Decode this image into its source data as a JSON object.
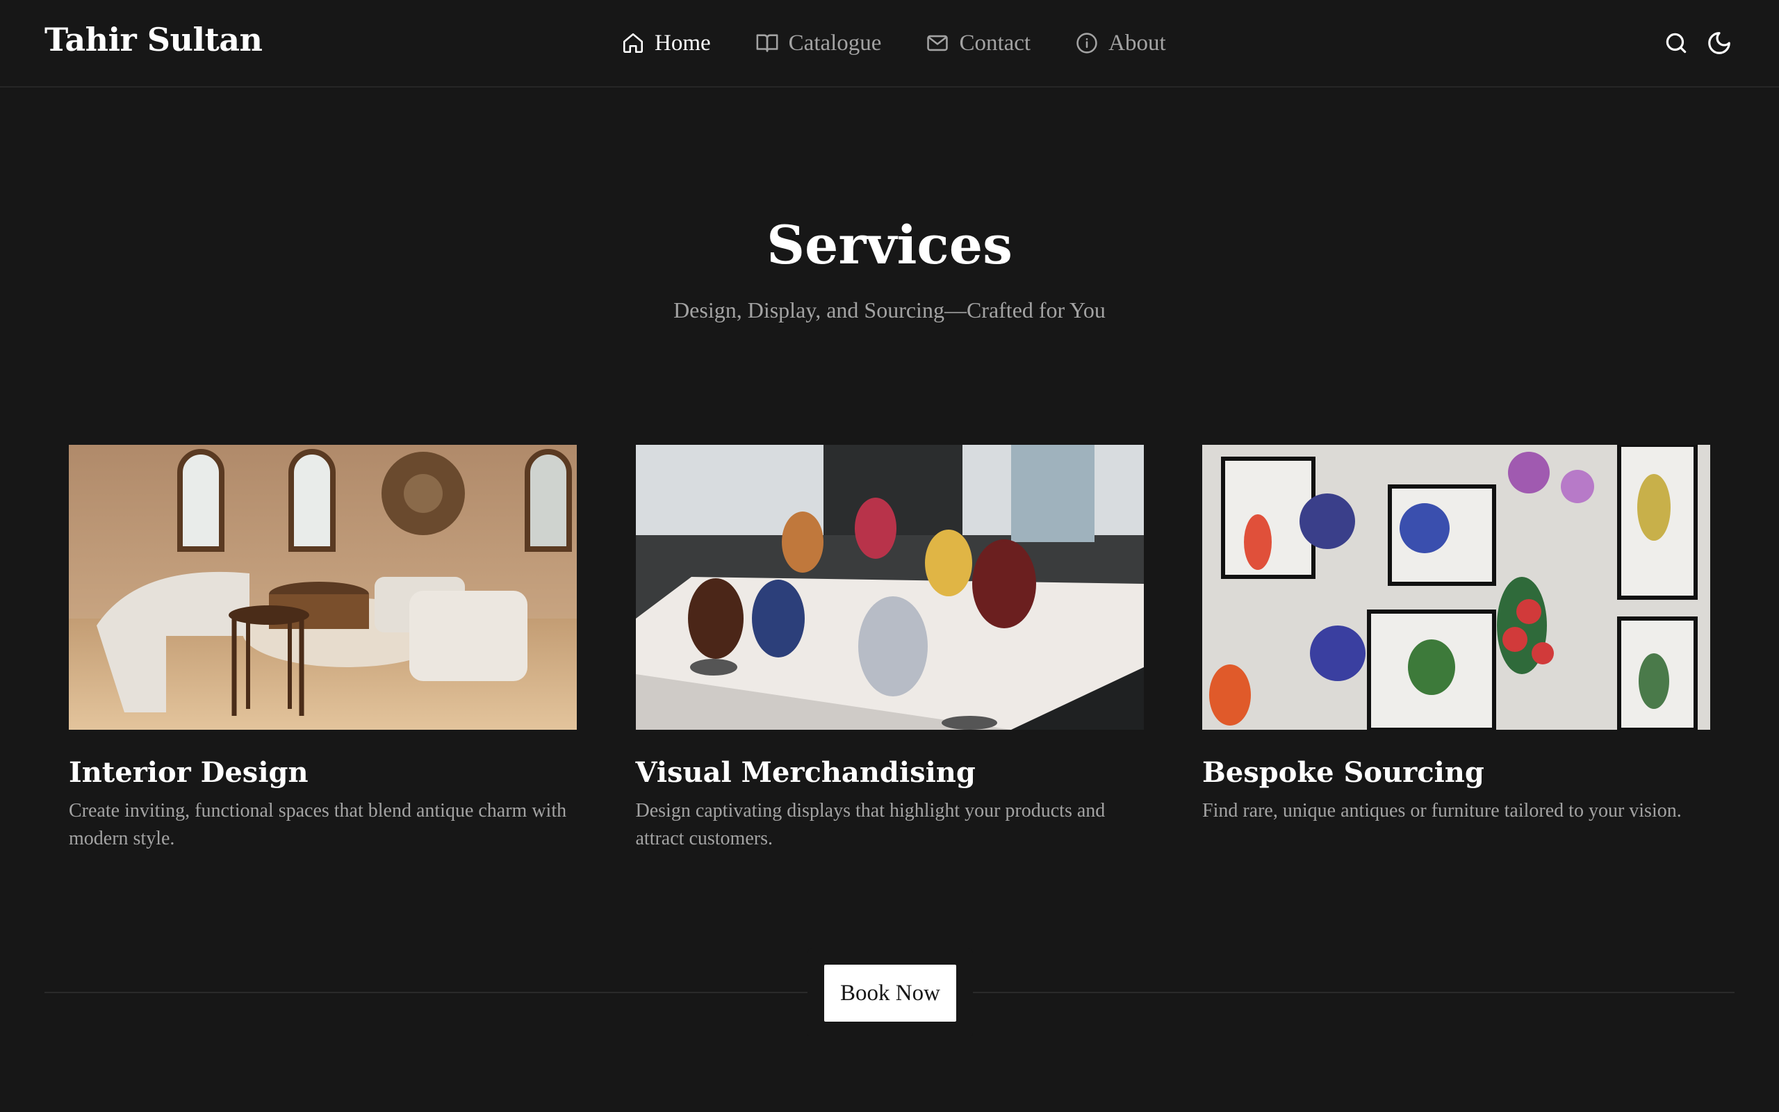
{
  "header": {
    "logo": "Tahir Sultan",
    "nav": [
      {
        "label": "Home",
        "icon": "home-icon",
        "active": true
      },
      {
        "label": "Catalogue",
        "icon": "book-open-icon",
        "active": false
      },
      {
        "label": "Contact",
        "icon": "mail-icon",
        "active": false
      },
      {
        "label": "About",
        "icon": "info-icon",
        "active": false
      }
    ],
    "actions": [
      "search-icon",
      "moon-icon"
    ]
  },
  "hero": {
    "title": "Services",
    "subtitle": "Design, Display, and Sourcing—Crafted for You"
  },
  "services": [
    {
      "title": "Interior Design",
      "description": "Create inviting, functional spaces that blend antique charm with modern style.",
      "image": "living-room-photo"
    },
    {
      "title": "Visual Merchandising",
      "description": "Design captivating displays that highlight your products and attract customers.",
      "image": "painted-eggs-display-photo"
    },
    {
      "title": "Bespoke Sourcing",
      "description": "Find rare, unique antiques or furniture tailored to your vision.",
      "image": "wall-art-flowers-photo"
    }
  ],
  "cta": {
    "label": "Book Now"
  },
  "colors": {
    "background": "#171717",
    "text": "#ffffff",
    "muted": "#a3a3a3",
    "border": "#262626"
  }
}
